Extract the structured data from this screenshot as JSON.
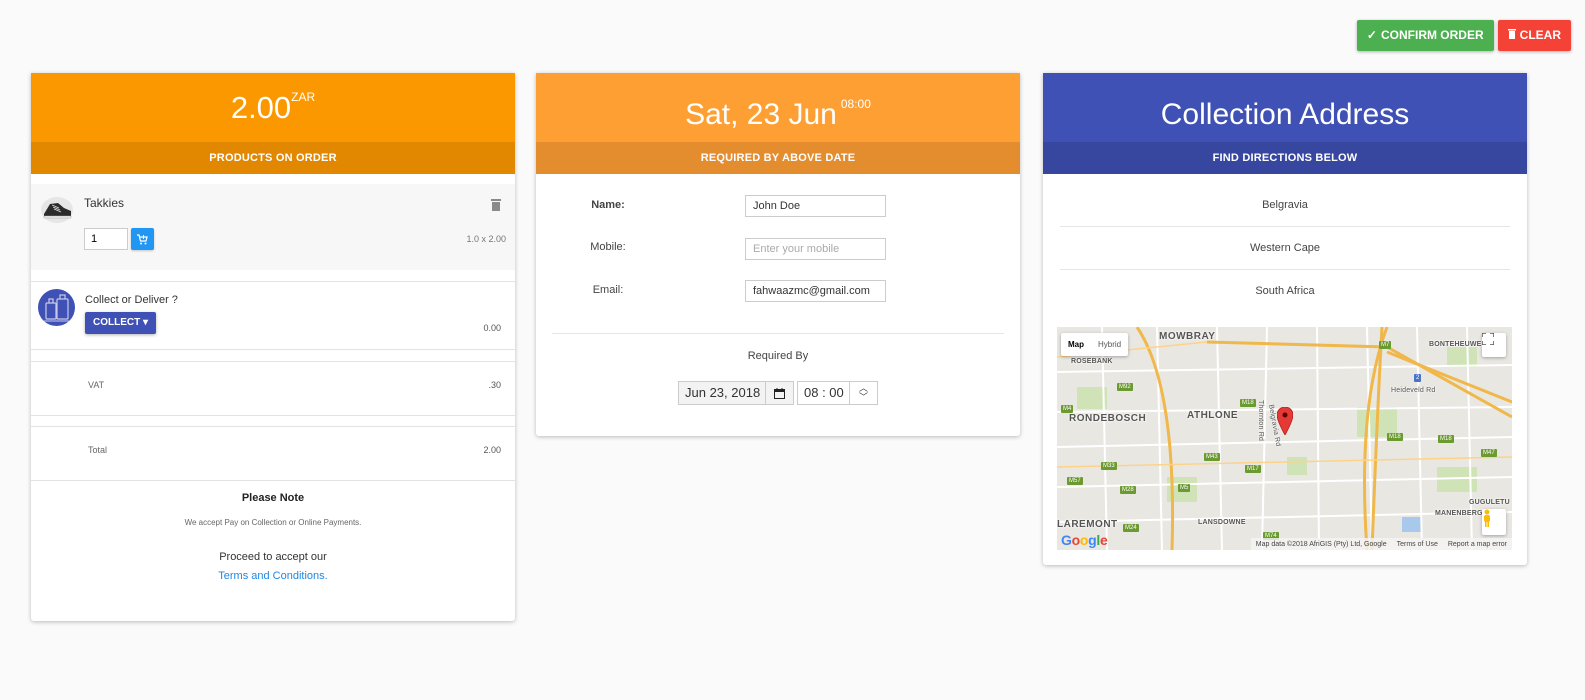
{
  "actions": {
    "confirm_label": "CONFIRM ORDER",
    "clear_label": "CLEAR",
    "confirm_color": "#4caf50",
    "clear_color": "#f44336"
  },
  "products_card": {
    "amount": "2.00",
    "currency": "ZAR",
    "subtitle": "PRODUCTS ON ORDER",
    "header_color": "#fb9800",
    "item": {
      "name": "Takkies",
      "quantity": "1",
      "line_amount": "1.0 x 2.00",
      "icon": "sneaker-icon"
    },
    "collect": {
      "title": "Collect or Deliver ?",
      "button_label": "COLLECT",
      "amount": "0.00"
    },
    "vat": {
      "label": "VAT",
      "value": ".30"
    },
    "total": {
      "label": "Total",
      "value": "2.00"
    },
    "note": {
      "title": "Please Note",
      "text": "We accept Pay on Collection or Online Payments.",
      "proceed": "Proceed to accept our",
      "link": "Terms and Conditions."
    }
  },
  "details_card": {
    "date": "Sat, 23 Jun",
    "time": "08:00",
    "subtitle": "REQUIRED BY ABOVE DATE",
    "header_color": "#fd9f33",
    "form": {
      "name_label": "Name:",
      "name_value": "John Doe",
      "mobile_label": "Mobile:",
      "mobile_placeholder": "Enter your mobile",
      "email_label": "Email:",
      "email_value": "fahwaazmc@gmail.com"
    },
    "required_by_label": "Required By",
    "date_input": "Jun 23, 2018",
    "time_input": "08 : 00"
  },
  "address_card": {
    "title": "Collection Address",
    "subtitle": "FIND DIRECTIONS BELOW",
    "header_color": "#3f51b5",
    "lines": [
      "Belgravia",
      "Western Cape",
      "South Africa"
    ],
    "map": {
      "type_map": "Map",
      "type_hybrid": "Hybrid",
      "places": [
        "MOWBRAY",
        "ROSEBANK",
        "RONDEBOSCH",
        "ATHLONE",
        "BONTEHEUWEL",
        "LAREMONT",
        "LANSDOWNE",
        "MANENBERG",
        "GUGULETU",
        "Thornton Rd",
        "Belgravia Rd",
        "Heideveld Rd"
      ],
      "shields": [
        "M7",
        "M92",
        "M4",
        "M18",
        "M18",
        "M18",
        "M47",
        "M43",
        "M17",
        "M33",
        "M57",
        "M28",
        "M5",
        "M24",
        "M74",
        "2"
      ],
      "logo_parts": [
        "G",
        "o",
        "o",
        "g",
        "l",
        "e"
      ],
      "footer": [
        "Map data ©2018 AfriGIS (Pty) Ltd, Google",
        "Terms of Use",
        "Report a map error"
      ]
    }
  }
}
